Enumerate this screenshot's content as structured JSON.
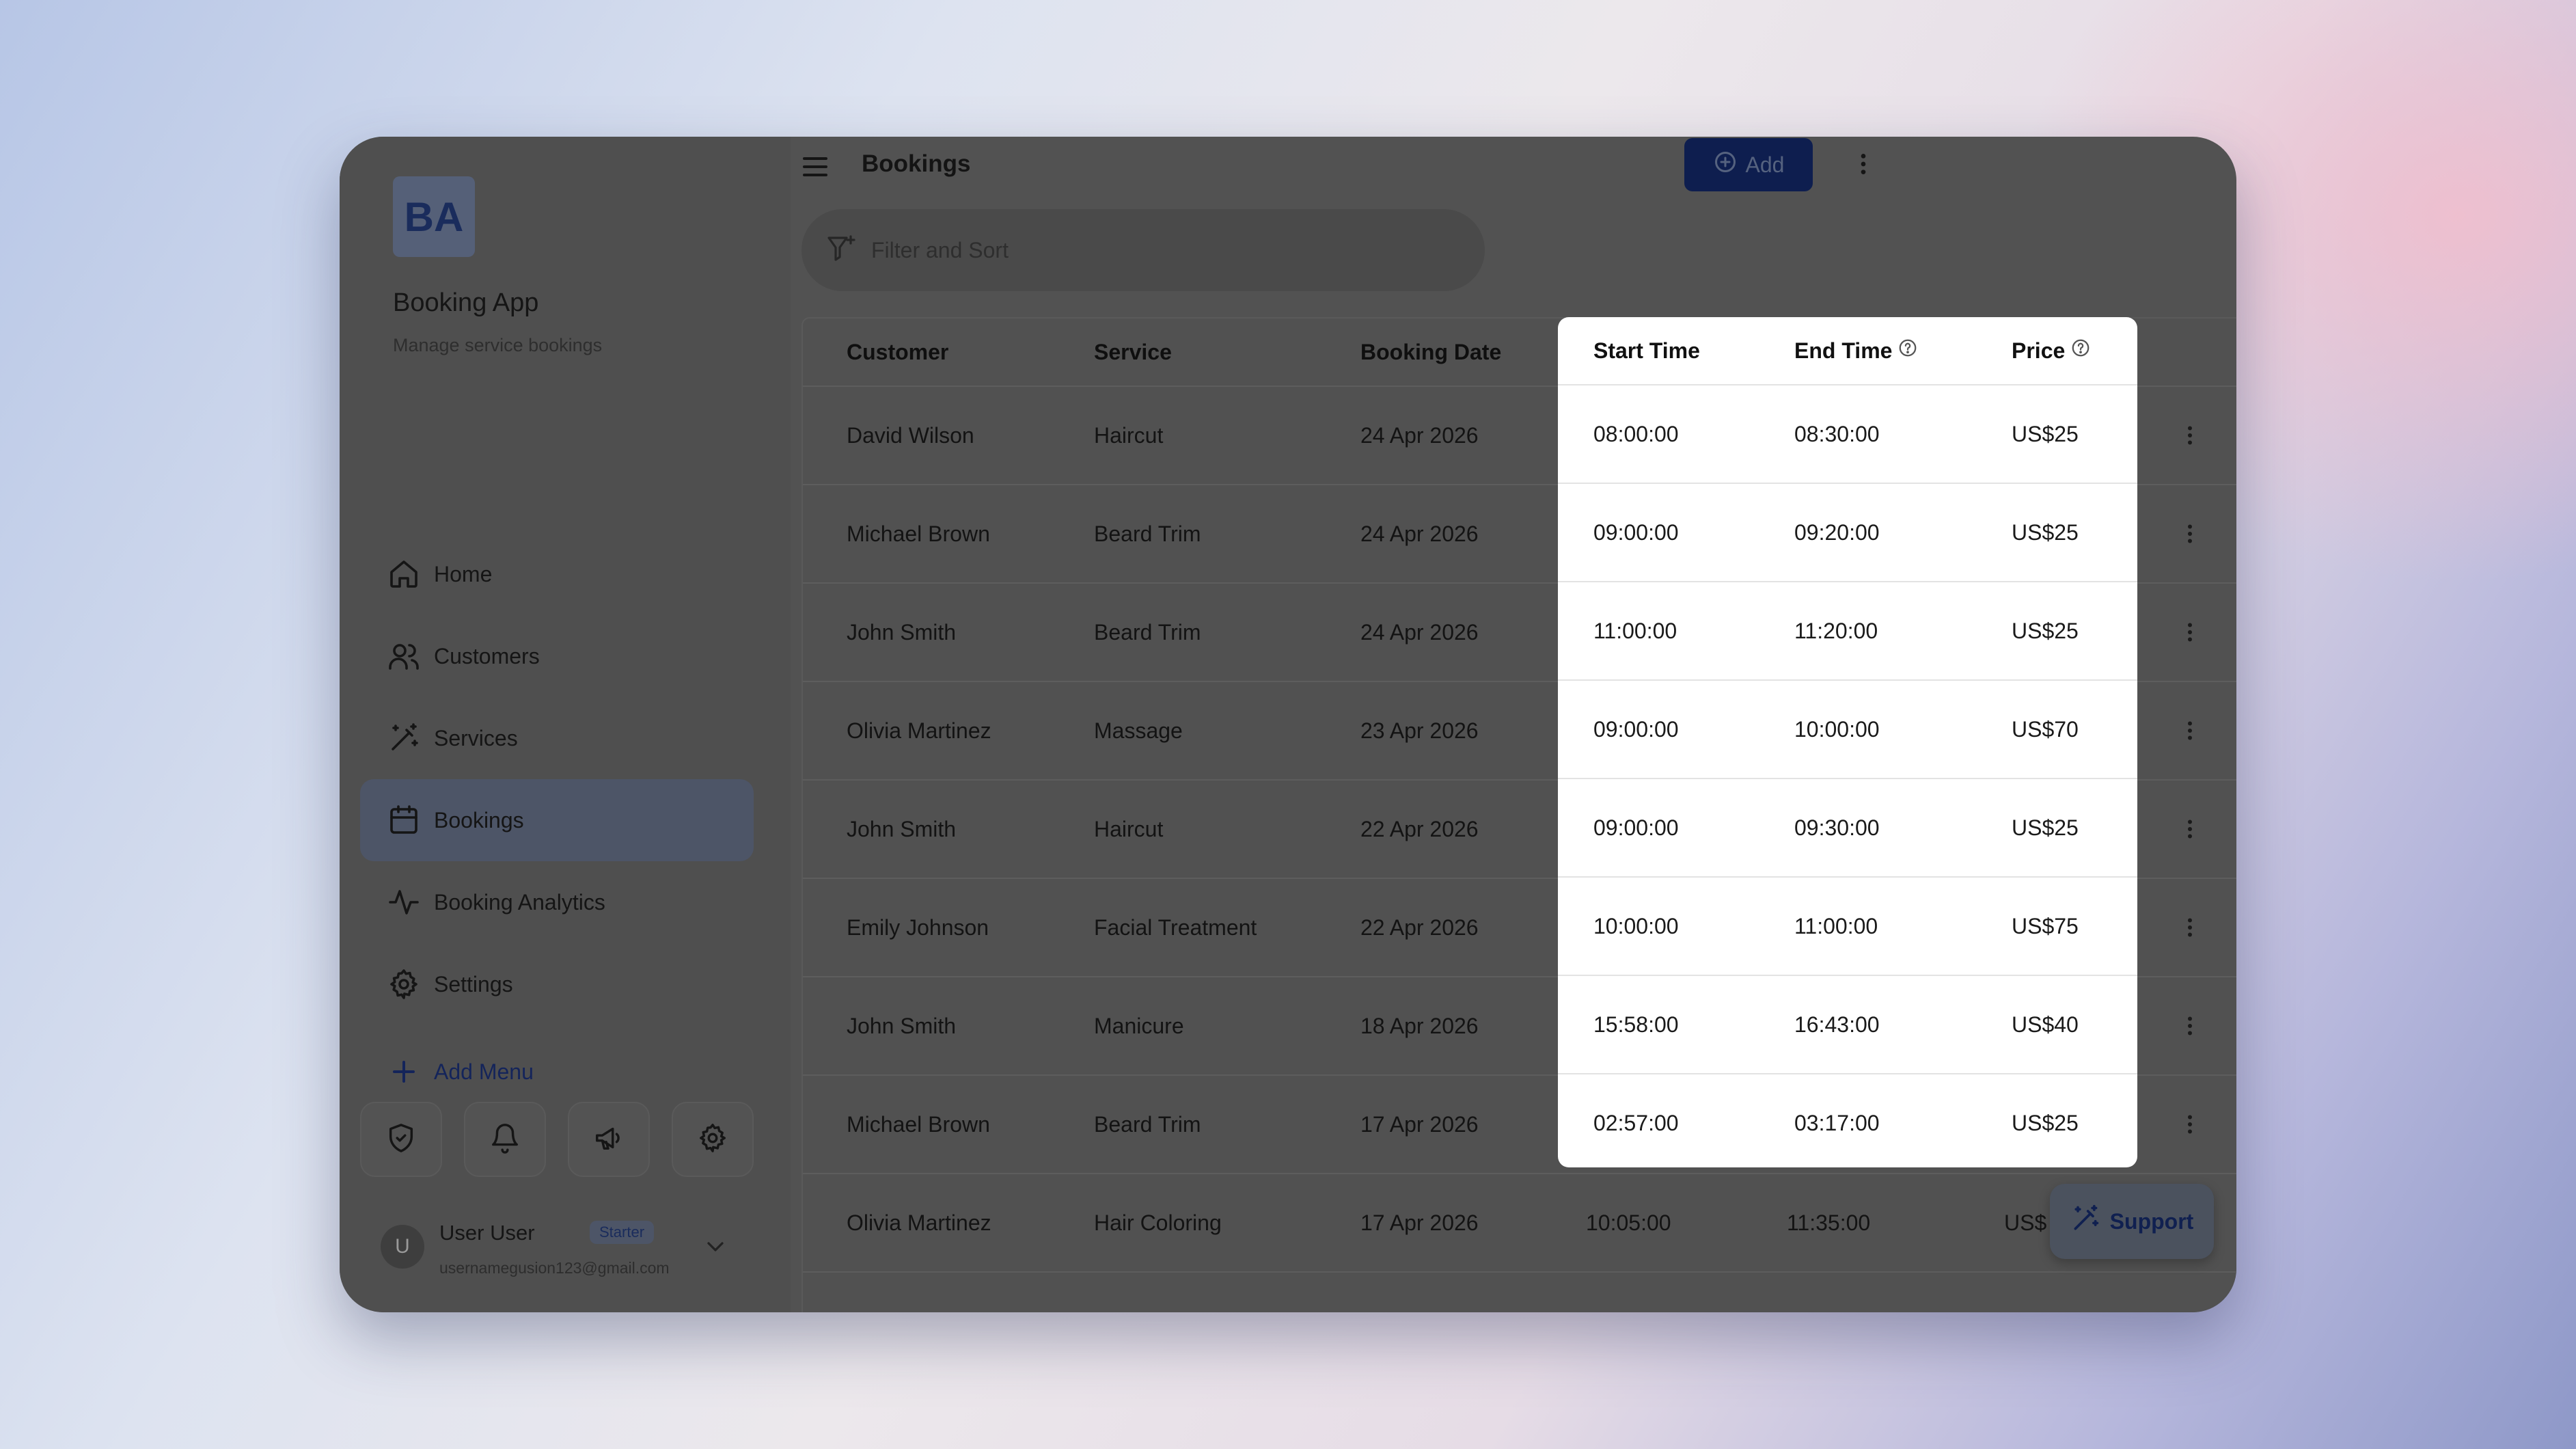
{
  "sidebar": {
    "logo": "BA",
    "app_name": "Booking App",
    "app_desc": "Manage service bookings",
    "items": [
      {
        "label": "Home",
        "icon": "home-icon"
      },
      {
        "label": "Customers",
        "icon": "users-icon"
      },
      {
        "label": "Services",
        "icon": "wand-icon"
      },
      {
        "label": "Bookings",
        "icon": "calendar-icon",
        "active": true
      },
      {
        "label": "Booking Analytics",
        "icon": "activity-icon"
      },
      {
        "label": "Settings",
        "icon": "gear-icon"
      }
    ],
    "add_menu": "Add Menu",
    "bottom_icons": [
      "shield-check-icon",
      "bell-icon",
      "megaphone-icon",
      "gear-icon"
    ],
    "user": {
      "initial": "U",
      "name": "User User",
      "plan": "Starter",
      "email": "usernamegusion123@gmail.com"
    }
  },
  "header": {
    "title": "Bookings",
    "add_label": "Add"
  },
  "filter": {
    "placeholder": "Filter and Sort"
  },
  "table": {
    "columns": [
      "Customer",
      "Service",
      "Booking Date",
      "Start Time",
      "End Time",
      "Price"
    ],
    "rows": [
      [
        "David Wilson",
        "Haircut",
        "24 Apr 2026",
        "08:00:00",
        "08:30:00",
        "US$25"
      ],
      [
        "Michael Brown",
        "Beard Trim",
        "24 Apr 2026",
        "09:00:00",
        "09:20:00",
        "US$25"
      ],
      [
        "John Smith",
        "Beard Trim",
        "24 Apr 2026",
        "11:00:00",
        "11:20:00",
        "US$25"
      ],
      [
        "Olivia Martinez",
        "Massage",
        "23 Apr 2026",
        "09:00:00",
        "10:00:00",
        "US$70"
      ],
      [
        "John Smith",
        "Haircut",
        "22 Apr 2026",
        "09:00:00",
        "09:30:00",
        "US$25"
      ],
      [
        "Emily Johnson",
        "Facial Treatment",
        "22 Apr 2026",
        "10:00:00",
        "11:00:00",
        "US$75"
      ],
      [
        "John Smith",
        "Manicure",
        "18 Apr 2026",
        "15:58:00",
        "16:43:00",
        "US$40"
      ],
      [
        "Michael Brown",
        "Beard Trim",
        "17 Apr 2026",
        "02:57:00",
        "03:17:00",
        "US$25"
      ],
      [
        "Olivia Martinez",
        "Hair Coloring",
        "17 Apr 2026",
        "10:05:00",
        "11:35:00",
        "US$"
      ]
    ]
  },
  "support": {
    "label": "Support"
  }
}
